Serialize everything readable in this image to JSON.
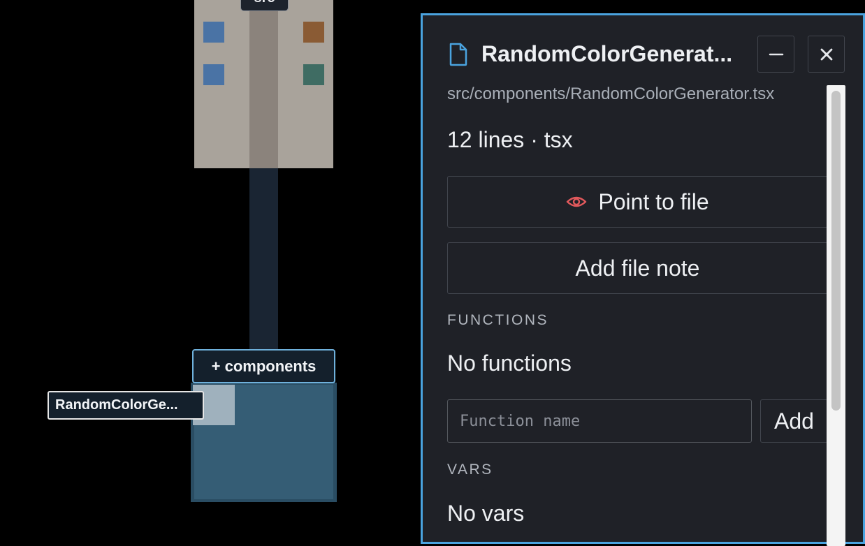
{
  "map": {
    "src_label": "src",
    "folder_label": "+ components",
    "hovered_file_label": "RandomColorGe...",
    "file_colors": [
      "#4a73a5",
      "#8a5b34",
      "#4a73a5",
      "#3f6c63"
    ]
  },
  "panel": {
    "title": "RandomColorGenerat...",
    "path": "src/components/RandomColorGenerator.tsx",
    "meta": "12 lines · tsx",
    "point_label": "Point to file",
    "note_label": "Add file note",
    "functions_heading": "FUNCTIONS",
    "no_functions": "No functions",
    "function_placeholder": "Function name",
    "add_label": "Add",
    "vars_heading": "VARS",
    "no_vars": "No vars",
    "accent_color": "#4aa3df",
    "eye_color": "#e2595c"
  }
}
